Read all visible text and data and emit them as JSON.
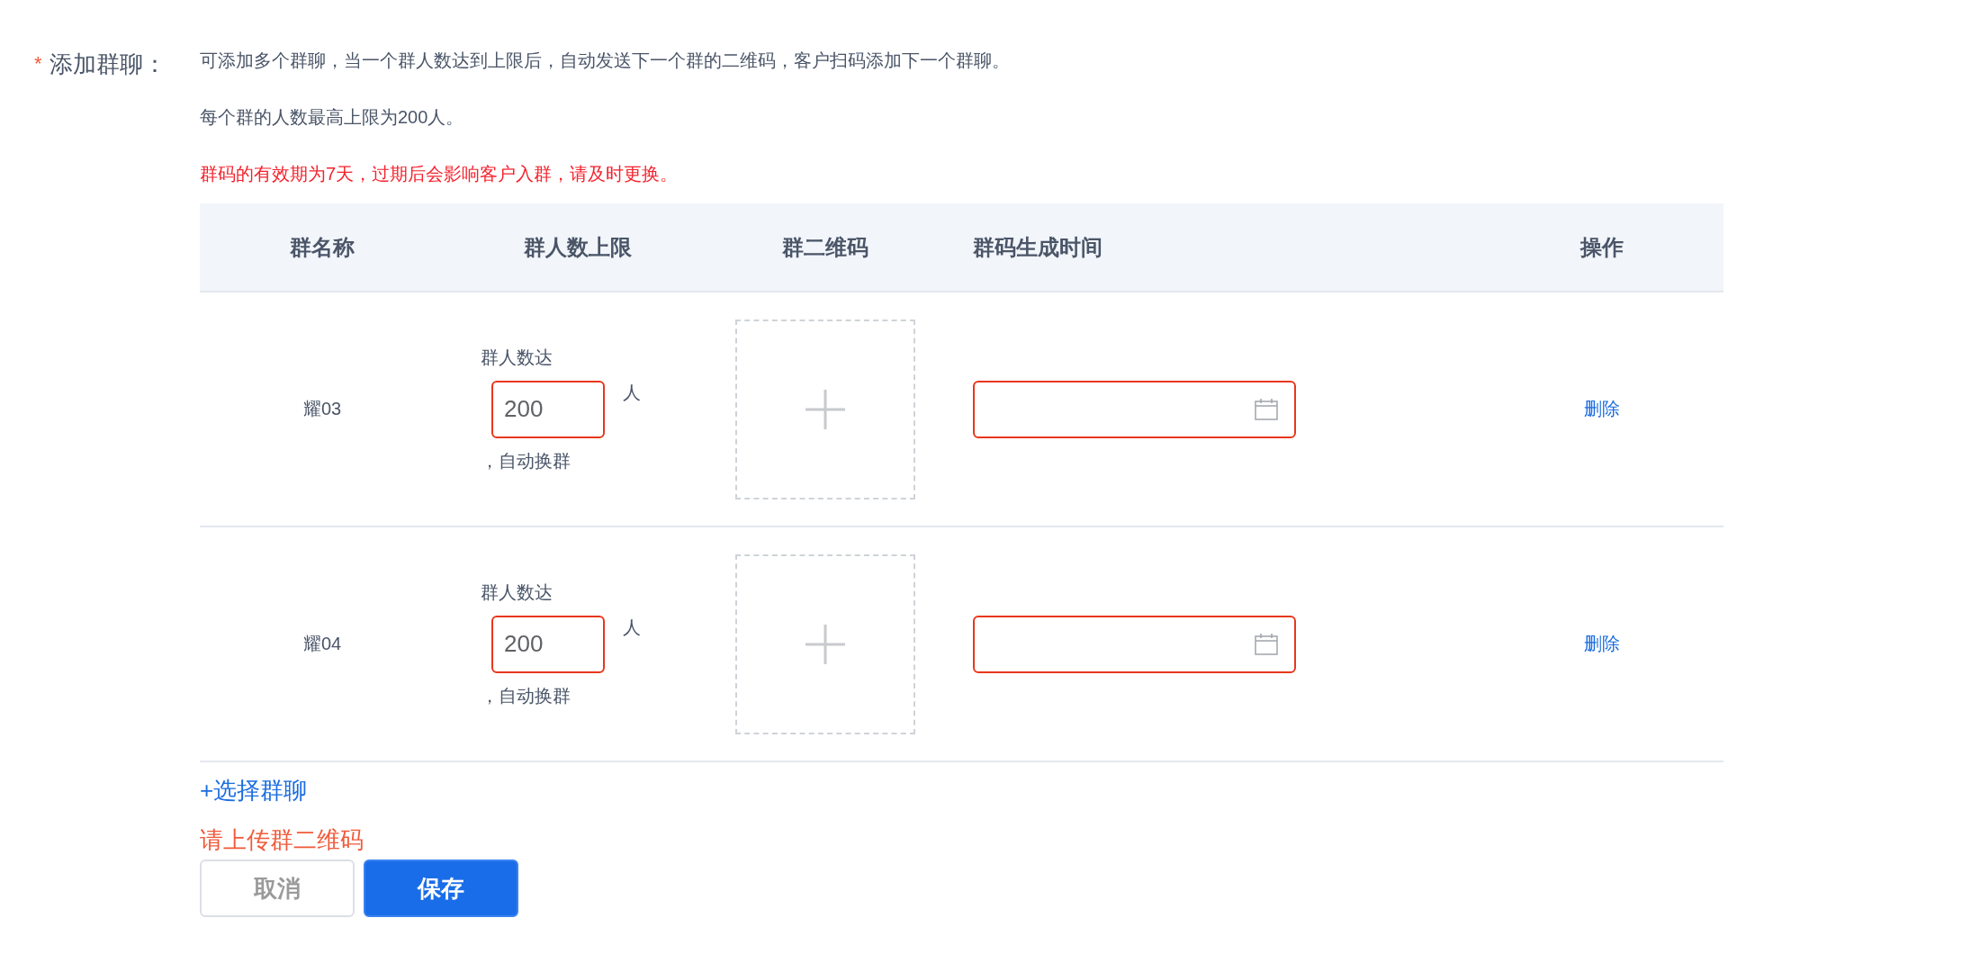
{
  "form": {
    "required_mark": "*",
    "label": "添加群聊：",
    "notes": [
      {
        "kind": "info",
        "text": "可添加多个群聊，当一个群人数达到上限后，自动发送下一个群的二维码，客户扫码添加下一个群聊。"
      },
      {
        "kind": "info",
        "text": "每个群的人数最高上限为200人。"
      },
      {
        "kind": "warning",
        "text": "群码的有效期为7天，过期后会影响客户入群，请及时更换。"
      }
    ],
    "table": {
      "columns": [
        "群名称",
        "群人数上限",
        "群二维码",
        "群码生成时间",
        "操作"
      ],
      "rows": [
        {
          "name": "耀03",
          "limit_prefix": "群人数达",
          "limit": "200",
          "limit_invalid": true,
          "unit": "人",
          "limit_suffix": "，自动换群",
          "date_invalid": true,
          "action": "删除"
        },
        {
          "name": "耀04",
          "limit_prefix": "群人数达",
          "limit": "200",
          "limit_invalid": true,
          "unit": "人",
          "limit_suffix": "，自动换群",
          "date_invalid": true,
          "action": "删除"
        }
      ]
    },
    "add_link": "+选择群聊",
    "error": "请上传群二维码",
    "buttons": [
      {
        "kind": "secondary",
        "label": "取消"
      },
      {
        "kind": "primary",
        "label": "保存"
      }
    ]
  }
}
